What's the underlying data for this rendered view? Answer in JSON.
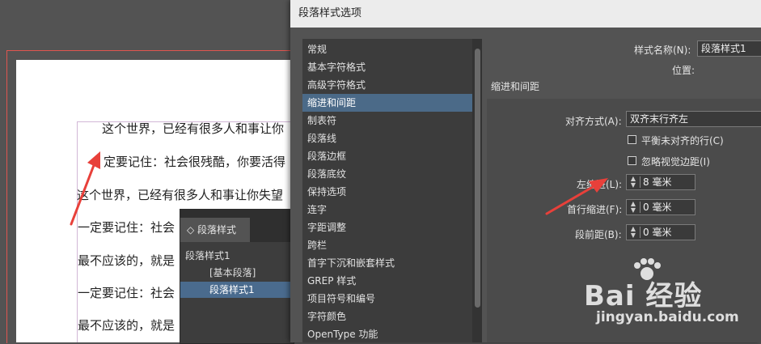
{
  "document": {
    "lines": [
      "这个世界，已经有很多人和事让你",
      "定要记住：社会很残酷，你要活得",
      "这个世界，已经有很多人和事让你失望",
      "一定要记住：社会",
      "最不应该的，就是",
      "一定要记住：社会",
      "最不应该的，就是"
    ]
  },
  "styles_panel": {
    "tab_label": "◇ 段落样式",
    "current_style": "段落样式1",
    "items": [
      "[基本段落]",
      "段落样式1"
    ]
  },
  "dialog": {
    "title": "段落样式选项",
    "categories": [
      "常规",
      "基本字符格式",
      "高级字符格式",
      "缩进和间距",
      "制表符",
      "段落线",
      "段落边框",
      "段落底纹",
      "保持选项",
      "连字",
      "字距调整",
      "跨栏",
      "首字下沉和嵌套样式",
      "GREP 样式",
      "项目符号和编号",
      "字符颜色",
      "OpenType 功能"
    ],
    "style_name_label": "样式名称(N):",
    "style_name_value": "段落样式1",
    "location_label": "位置:",
    "section_title": "缩进和间距",
    "alignment_label": "对齐方式(A):",
    "alignment_value": "双齐末行齐左",
    "balance_ragged_label": "平衡未对齐的行(C)",
    "ignore_optical_label": "忽略视觉边距(I)",
    "left_indent_label": "左缩进(L):",
    "left_indent_value": "8 毫米",
    "first_line_indent_label": "首行缩进(F):",
    "first_line_indent_value": "0 毫米",
    "space_before_label": "段前距(B):",
    "space_before_value": "0 毫米"
  },
  "watermark": {
    "brand": "Bai 经验",
    "url": "jingyan.baidu.com"
  },
  "colors": {
    "annotation_arrow": "#e8403a",
    "selection": "#4b6a88"
  }
}
